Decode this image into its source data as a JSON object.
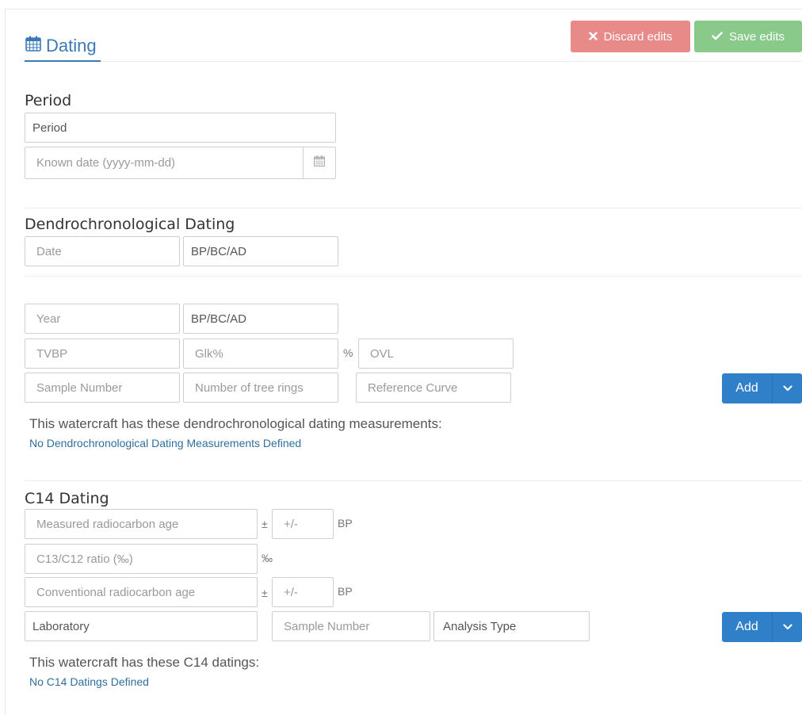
{
  "header": {
    "title": "Dating",
    "discard_label": "Discard edits",
    "save_label": "Save edits"
  },
  "period": {
    "heading": "Period",
    "period_placeholder": "Period",
    "known_date_placeholder": "Known date (yyyy-mm-dd)"
  },
  "dendro": {
    "heading": "Dendrochronological Dating",
    "date_placeholder": "Date",
    "date_era_placeholder": "BP/BC/AD",
    "year_placeholder": "Year",
    "year_era_placeholder": "BP/BC/AD",
    "tvbp_placeholder": "TVBP",
    "glk_placeholder": "Glk%",
    "glk_suffix": "%",
    "ovl_placeholder": "OVL",
    "sample_placeholder": "Sample Number",
    "rings_placeholder": "Number of tree rings",
    "curve_placeholder": "Reference Curve",
    "add_label": "Add",
    "info_text": "This watercraft has these dendrochronological dating measurements:",
    "empty_text": "No Dendrochronological Dating Measurements Defined"
  },
  "c14": {
    "heading": "C14 Dating",
    "measured_placeholder": "Measured radiocarbon age",
    "plusminus_symbol": "±",
    "measured_err_placeholder": "+/-",
    "measured_unit": "BP",
    "ratio_placeholder": "C13/C12 ratio (‰)",
    "ratio_unit": "‰",
    "conventional_placeholder": "Conventional radiocarbon age",
    "conventional_err_placeholder": "+/-",
    "conventional_unit": "BP",
    "laboratory_placeholder": "Laboratory",
    "sample_placeholder": "Sample Number",
    "analysis_placeholder": "Analysis Type",
    "add_label": "Add",
    "info_text": "This watercraft has these C14 datings:",
    "empty_text": "No C14 Datings Defined"
  },
  "colors": {
    "accent": "#3a7ab8",
    "discard": "#e88a88",
    "save": "#89c98a",
    "add": "#2f80c9"
  }
}
